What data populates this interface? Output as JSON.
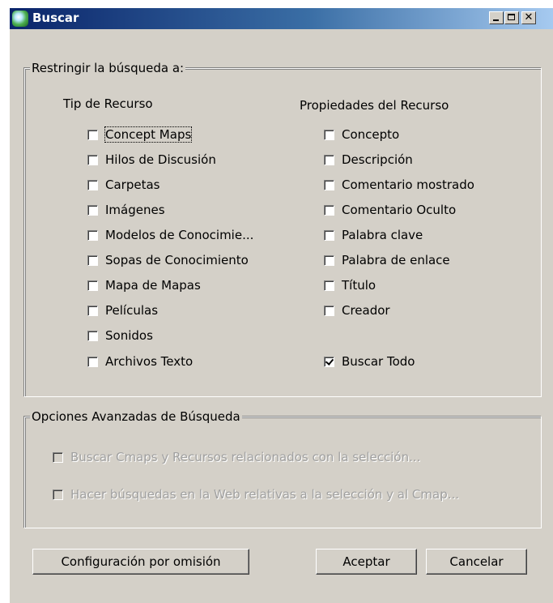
{
  "window": {
    "title": "Buscar"
  },
  "restrict": {
    "group_title": "Restringir la búsqueda a:",
    "resource_type": {
      "heading": "Tip de Recurso",
      "items": [
        {
          "label": "Concept Maps",
          "checked": false
        },
        {
          "label": "Hilos de Discusión",
          "checked": false
        },
        {
          "label": "Carpetas",
          "checked": false
        },
        {
          "label": "Imágenes",
          "checked": false
        },
        {
          "label": "Modelos de Conocimie...",
          "checked": false
        },
        {
          "label": "Sopas de Conocimiento",
          "checked": false
        },
        {
          "label": "Mapa de Mapas",
          "checked": false
        },
        {
          "label": "Películas",
          "checked": false
        },
        {
          "label": "Sonidos",
          "checked": false
        },
        {
          "label": "Archivos Texto",
          "checked": false
        }
      ]
    },
    "resource_props": {
      "heading": "Propiedades del Recurso",
      "items": [
        {
          "label": "Concepto",
          "checked": false
        },
        {
          "label": "Descripción",
          "checked": false
        },
        {
          "label": "Comentario mostrado",
          "checked": false
        },
        {
          "label": "Comentario Oculto",
          "checked": false
        },
        {
          "label": "Palabra clave",
          "checked": false
        },
        {
          "label": "Palabra de enlace",
          "checked": false
        },
        {
          "label": "Título",
          "checked": false
        },
        {
          "label": "Creador",
          "checked": false
        }
      ],
      "search_all": {
        "label": "Buscar Todo",
        "checked": true
      }
    }
  },
  "advanced": {
    "group_title": "Opciones Avanzadas de Búsqueda",
    "items": [
      {
        "label": "Buscar Cmaps y Recursos relacionados con la selección...",
        "checked": false,
        "enabled": false
      },
      {
        "label": "Hacer búsquedas en la Web relativas a la selección y al Cmap...",
        "checked": false,
        "enabled": false
      }
    ]
  },
  "buttons": {
    "defaults": "Configuración por omisión",
    "accept": "Aceptar",
    "cancel": "Cancelar"
  }
}
